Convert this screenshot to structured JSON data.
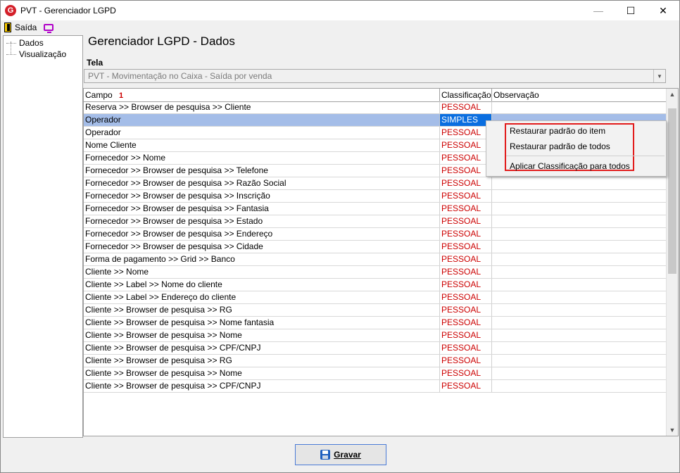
{
  "window": {
    "title": "PVT - Gerenciador LGPD",
    "app_icon_letter": "G"
  },
  "menubar": {
    "exit_label": "Saída"
  },
  "tree": {
    "items": [
      "Dados",
      "Visualização"
    ]
  },
  "page": {
    "title": "Gerenciador LGPD - Dados"
  },
  "tela": {
    "label": "Tela",
    "selected": "PVT - Movimentação no Caixa - Saída por venda"
  },
  "grid": {
    "columns": [
      "Campo",
      "Classificação",
      "Observação"
    ],
    "sort_indicator": "1",
    "rows": [
      {
        "campo": "Reserva >> Browser de pesquisa >> Cliente",
        "classificacao": "PESSOAL",
        "observacao": ""
      },
      {
        "campo": "Operador",
        "classificacao": "SIMPLES",
        "observacao": ""
      },
      {
        "campo": "Operador",
        "classificacao": "PESSOAL",
        "observacao": ""
      },
      {
        "campo": "Nome Cliente",
        "classificacao": "PESSOAL",
        "observacao": ""
      },
      {
        "campo": "Fornecedor >> Nome",
        "classificacao": "PESSOAL",
        "observacao": ""
      },
      {
        "campo": "Fornecedor >> Browser de pesquisa >> Telefone",
        "classificacao": "PESSOAL",
        "observacao": ""
      },
      {
        "campo": "Fornecedor >> Browser de pesquisa >> Razão Social",
        "classificacao": "PESSOAL",
        "observacao": ""
      },
      {
        "campo": "Fornecedor >> Browser de pesquisa >> Inscrição",
        "classificacao": "PESSOAL",
        "observacao": ""
      },
      {
        "campo": "Fornecedor >> Browser de pesquisa >> Fantasia",
        "classificacao": "PESSOAL",
        "observacao": ""
      },
      {
        "campo": "Fornecedor >> Browser de pesquisa >> Estado",
        "classificacao": "PESSOAL",
        "observacao": ""
      },
      {
        "campo": "Fornecedor >> Browser de pesquisa >> Endereço",
        "classificacao": "PESSOAL",
        "observacao": ""
      },
      {
        "campo": "Fornecedor >> Browser de pesquisa >> Cidade",
        "classificacao": "PESSOAL",
        "observacao": ""
      },
      {
        "campo": "Forma de pagamento >> Grid >> Banco",
        "classificacao": "PESSOAL",
        "observacao": ""
      },
      {
        "campo": "Cliente >> Nome",
        "classificacao": "PESSOAL",
        "observacao": ""
      },
      {
        "campo": "Cliente >> Label >> Nome do cliente",
        "classificacao": "PESSOAL",
        "observacao": ""
      },
      {
        "campo": "Cliente >> Label >> Endereço do cliente",
        "classificacao": "PESSOAL",
        "observacao": ""
      },
      {
        "campo": "Cliente >> Browser de pesquisa >> RG",
        "classificacao": "PESSOAL",
        "observacao": ""
      },
      {
        "campo": "Cliente >> Browser de pesquisa >> Nome fantasia",
        "classificacao": "PESSOAL",
        "observacao": ""
      },
      {
        "campo": "Cliente >> Browser de pesquisa >> Nome",
        "classificacao": "PESSOAL",
        "observacao": ""
      },
      {
        "campo": "Cliente >> Browser de pesquisa >> CPF/CNPJ",
        "classificacao": "PESSOAL",
        "observacao": ""
      },
      {
        "campo": "Cliente  >> Browser de pesquisa >> RG",
        "classificacao": "PESSOAL",
        "observacao": ""
      },
      {
        "campo": "Cliente  >> Browser de pesquisa >> Nome",
        "classificacao": "PESSOAL",
        "observacao": ""
      },
      {
        "campo": "Cliente  >> Browser de pesquisa >> CPF/CNPJ",
        "classificacao": "PESSOAL",
        "observacao": ""
      }
    ]
  },
  "context_menu": {
    "items": [
      "Restaurar padrão do item",
      "Restaurar padrão de todos",
      "Aplicar Classificação para todos"
    ]
  },
  "footer": {
    "save_label": "Gravar"
  },
  "colors": {
    "classification_text": "#c00000",
    "selection": "#0a6ee0",
    "highlight_box": "#e21b1b"
  }
}
